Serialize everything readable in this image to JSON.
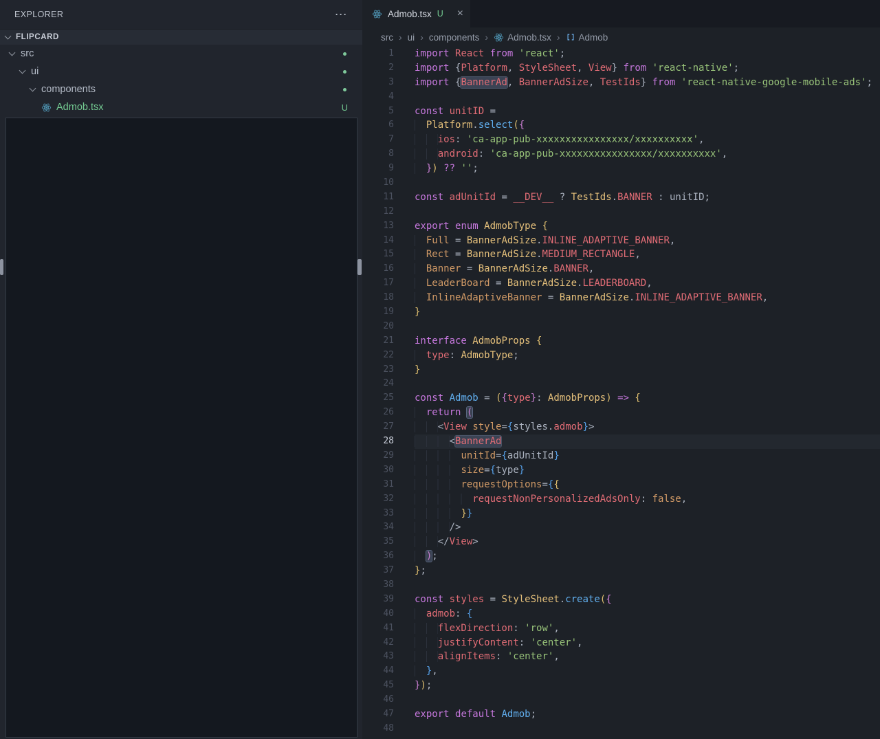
{
  "colors": {
    "react_icon": "#519aba",
    "git_untracked": "#73c991",
    "accent_keyword": "#c678dd"
  },
  "explorer": {
    "header": "EXPLORER",
    "more_icon": "⋯",
    "section": "FLIPCARD",
    "tree": [
      {
        "label": "src",
        "kind": "folder",
        "depth": 0,
        "badge": "dot"
      },
      {
        "label": "ui",
        "kind": "folder",
        "depth": 1,
        "badge": "dot"
      },
      {
        "label": "components",
        "kind": "folder",
        "depth": 2,
        "badge": "dot"
      },
      {
        "label": "Admob.tsx",
        "kind": "react-file",
        "depth": 3,
        "badge": "U"
      }
    ]
  },
  "tab": {
    "icon": "react-icon",
    "title": "Admob.tsx",
    "git_status": "U",
    "close_icon": "×"
  },
  "breadcrumb_separator": "›",
  "breadcrumbs": [
    {
      "label": "src"
    },
    {
      "label": "ui"
    },
    {
      "label": "components"
    },
    {
      "label": "Admob.tsx",
      "icon": "react-icon"
    },
    {
      "label": "Admob",
      "icon": "symbol-icon"
    }
  ],
  "editor": {
    "active_line": 28,
    "lines": [
      {
        "n": 1,
        "t": [
          [
            "kw",
            "import"
          ],
          [
            "def",
            " "
          ],
          [
            "var",
            "React"
          ],
          [
            "def",
            " "
          ],
          [
            "kw",
            "from"
          ],
          [
            "def",
            " "
          ],
          [
            "str",
            "'react'"
          ],
          [
            "def",
            ";"
          ]
        ]
      },
      {
        "n": 2,
        "t": [
          [
            "kw",
            "import"
          ],
          [
            "def",
            " {"
          ],
          [
            "var",
            "Platform"
          ],
          [
            "def",
            ", "
          ],
          [
            "var",
            "StyleSheet"
          ],
          [
            "def",
            ", "
          ],
          [
            "var",
            "View"
          ],
          [
            "def",
            "} "
          ],
          [
            "kw",
            "from"
          ],
          [
            "def",
            " "
          ],
          [
            "str",
            "'react-native'"
          ],
          [
            "def",
            ";"
          ]
        ]
      },
      {
        "n": 3,
        "t": [
          [
            "kw",
            "import"
          ],
          [
            "def",
            " {"
          ],
          [
            "var",
            "BannerAd",
            "hl"
          ],
          [
            "def",
            ", "
          ],
          [
            "var",
            "BannerAdSize"
          ],
          [
            "def",
            ", "
          ],
          [
            "var",
            "TestIds"
          ],
          [
            "def",
            "} "
          ],
          [
            "kw",
            "from"
          ],
          [
            "def",
            " "
          ],
          [
            "str",
            "'react-native-google-mobile-ads'"
          ],
          [
            "def",
            ";"
          ]
        ]
      },
      {
        "n": 4,
        "t": []
      },
      {
        "n": 5,
        "t": [
          [
            "kw",
            "const"
          ],
          [
            "def",
            " "
          ],
          [
            "var",
            "unitID"
          ],
          [
            "def",
            " ="
          ]
        ]
      },
      {
        "n": 6,
        "t": [
          [
            "ind",
            "  "
          ],
          [
            "typ",
            "Platform"
          ],
          [
            "def",
            "."
          ],
          [
            "fn",
            "select"
          ],
          [
            "b1",
            "("
          ],
          [
            "b2",
            "{"
          ]
        ]
      },
      {
        "n": 7,
        "t": [
          [
            "ind",
            "    "
          ],
          [
            "var",
            "ios"
          ],
          [
            "def",
            ": "
          ],
          [
            "str",
            "'ca-app-pub-xxxxxxxxxxxxxxxx/xxxxxxxxxx'"
          ],
          [
            "def",
            ","
          ]
        ]
      },
      {
        "n": 8,
        "t": [
          [
            "ind",
            "    "
          ],
          [
            "var",
            "android"
          ],
          [
            "def",
            ": "
          ],
          [
            "str",
            "'ca-app-pub-xxxxxxxxxxxxxxxx/xxxxxxxxxx'"
          ],
          [
            "def",
            ","
          ]
        ]
      },
      {
        "n": 9,
        "t": [
          [
            "ind",
            "  "
          ],
          [
            "b2",
            "}"
          ],
          [
            "b1",
            ")"
          ],
          [
            "def",
            " "
          ],
          [
            "kw",
            "??"
          ],
          [
            "def",
            " "
          ],
          [
            "str",
            "''"
          ],
          [
            "def",
            ";"
          ]
        ]
      },
      {
        "n": 10,
        "t": []
      },
      {
        "n": 11,
        "t": [
          [
            "kw",
            "const"
          ],
          [
            "def",
            " "
          ],
          [
            "var",
            "adUnitId"
          ],
          [
            "def",
            " = "
          ],
          [
            "var",
            "__DEV__"
          ],
          [
            "def",
            " ? "
          ],
          [
            "typ",
            "TestIds"
          ],
          [
            "def",
            "."
          ],
          [
            "var",
            "BANNER"
          ],
          [
            "def",
            " : "
          ],
          [
            "def",
            "unitID"
          ],
          [
            "def",
            ";"
          ]
        ]
      },
      {
        "n": 12,
        "t": []
      },
      {
        "n": 13,
        "t": [
          [
            "kw",
            "export"
          ],
          [
            "def",
            " "
          ],
          [
            "kw",
            "enum"
          ],
          [
            "def",
            " "
          ],
          [
            "typ",
            "AdmobType"
          ],
          [
            "def",
            " "
          ],
          [
            "b1",
            "{"
          ]
        ]
      },
      {
        "n": 14,
        "t": [
          [
            "ind",
            "  "
          ],
          [
            "orn",
            "Full"
          ],
          [
            "def",
            " = "
          ],
          [
            "typ",
            "BannerAdSize"
          ],
          [
            "def",
            "."
          ],
          [
            "var",
            "INLINE_ADAPTIVE_BANNER"
          ],
          [
            "def",
            ","
          ]
        ]
      },
      {
        "n": 15,
        "t": [
          [
            "ind",
            "  "
          ],
          [
            "orn",
            "Rect"
          ],
          [
            "def",
            " = "
          ],
          [
            "typ",
            "BannerAdSize"
          ],
          [
            "def",
            "."
          ],
          [
            "var",
            "MEDIUM_RECTANGLE"
          ],
          [
            "def",
            ","
          ]
        ]
      },
      {
        "n": 16,
        "t": [
          [
            "ind",
            "  "
          ],
          [
            "orn",
            "Banner"
          ],
          [
            "def",
            " = "
          ],
          [
            "typ",
            "BannerAdSize"
          ],
          [
            "def",
            "."
          ],
          [
            "var",
            "BANNER"
          ],
          [
            "def",
            ","
          ]
        ]
      },
      {
        "n": 17,
        "t": [
          [
            "ind",
            "  "
          ],
          [
            "orn",
            "LeaderBoard"
          ],
          [
            "def",
            " = "
          ],
          [
            "typ",
            "BannerAdSize"
          ],
          [
            "def",
            "."
          ],
          [
            "var",
            "LEADERBOARD"
          ],
          [
            "def",
            ","
          ]
        ]
      },
      {
        "n": 18,
        "t": [
          [
            "ind",
            "  "
          ],
          [
            "orn",
            "InlineAdaptiveBanner"
          ],
          [
            "def",
            " = "
          ],
          [
            "typ",
            "BannerAdSize"
          ],
          [
            "def",
            "."
          ],
          [
            "var",
            "INLINE_ADAPTIVE_BANNER"
          ],
          [
            "def",
            ","
          ]
        ]
      },
      {
        "n": 19,
        "t": [
          [
            "b1",
            "}"
          ]
        ]
      },
      {
        "n": 20,
        "t": []
      },
      {
        "n": 21,
        "t": [
          [
            "kw",
            "interface"
          ],
          [
            "def",
            " "
          ],
          [
            "typ",
            "AdmobProps"
          ],
          [
            "def",
            " "
          ],
          [
            "b1",
            "{"
          ]
        ]
      },
      {
        "n": 22,
        "t": [
          [
            "ind",
            "  "
          ],
          [
            "var",
            "type"
          ],
          [
            "def",
            ": "
          ],
          [
            "typ",
            "AdmobType"
          ],
          [
            "def",
            ";"
          ]
        ]
      },
      {
        "n": 23,
        "t": [
          [
            "b1",
            "}"
          ]
        ]
      },
      {
        "n": 24,
        "t": []
      },
      {
        "n": 25,
        "t": [
          [
            "kw",
            "const"
          ],
          [
            "def",
            " "
          ],
          [
            "fn",
            "Admob"
          ],
          [
            "def",
            " = "
          ],
          [
            "b1",
            "("
          ],
          [
            "b2",
            "{"
          ],
          [
            "var",
            "type"
          ],
          [
            "b2",
            "}"
          ],
          [
            "def",
            ": "
          ],
          [
            "typ",
            "AdmobProps"
          ],
          [
            "b1",
            ")"
          ],
          [
            "def",
            " "
          ],
          [
            "kw",
            "=>"
          ],
          [
            "def",
            " "
          ],
          [
            "b1",
            "{"
          ]
        ]
      },
      {
        "n": 26,
        "t": [
          [
            "ind",
            "  "
          ],
          [
            "kw",
            "return"
          ],
          [
            "def",
            " "
          ],
          [
            "b2",
            "(",
            "bm"
          ]
        ]
      },
      {
        "n": 27,
        "t": [
          [
            "ind",
            "    "
          ],
          [
            "def",
            "<"
          ],
          [
            "var",
            "View"
          ],
          [
            "def",
            " "
          ],
          [
            "orn",
            "style"
          ],
          [
            "def",
            "="
          ],
          [
            "b3",
            "{"
          ],
          [
            "def",
            "styles"
          ],
          [
            "def",
            "."
          ],
          [
            "var",
            "admob"
          ],
          [
            "b3",
            "}"
          ],
          [
            "def",
            ">"
          ]
        ]
      },
      {
        "n": 28,
        "t": [
          [
            "ind",
            "      "
          ],
          [
            "def",
            "<"
          ],
          [
            "var",
            "BannerAd",
            "hl"
          ]
        ]
      },
      {
        "n": 29,
        "t": [
          [
            "ind",
            "        "
          ],
          [
            "orn",
            "unitId"
          ],
          [
            "def",
            "="
          ],
          [
            "b3",
            "{"
          ],
          [
            "def",
            "adUnitId"
          ],
          [
            "b3",
            "}"
          ]
        ]
      },
      {
        "n": 30,
        "t": [
          [
            "ind",
            "        "
          ],
          [
            "orn",
            "size"
          ],
          [
            "def",
            "="
          ],
          [
            "b3",
            "{"
          ],
          [
            "def",
            "type"
          ],
          [
            "b3",
            "}"
          ]
        ]
      },
      {
        "n": 31,
        "t": [
          [
            "ind",
            "        "
          ],
          [
            "orn",
            "requestOptions"
          ],
          [
            "def",
            "="
          ],
          [
            "b3",
            "{"
          ],
          [
            "b1",
            "{"
          ]
        ]
      },
      {
        "n": 32,
        "t": [
          [
            "ind",
            "          "
          ],
          [
            "var",
            "requestNonPersonalizedAdsOnly"
          ],
          [
            "def",
            ": "
          ],
          [
            "orn",
            "false"
          ],
          [
            "def",
            ","
          ]
        ]
      },
      {
        "n": 33,
        "t": [
          [
            "ind",
            "        "
          ],
          [
            "b1",
            "}"
          ],
          [
            "b3",
            "}"
          ]
        ]
      },
      {
        "n": 34,
        "t": [
          [
            "ind",
            "      "
          ],
          [
            "def",
            "/>"
          ]
        ]
      },
      {
        "n": 35,
        "t": [
          [
            "ind",
            "    "
          ],
          [
            "def",
            "</"
          ],
          [
            "var",
            "View"
          ],
          [
            "def",
            ">"
          ]
        ]
      },
      {
        "n": 36,
        "t": [
          [
            "ind",
            "  "
          ],
          [
            "b2",
            ")",
            "bm"
          ],
          [
            "def",
            ";"
          ]
        ]
      },
      {
        "n": 37,
        "t": [
          [
            "b1",
            "}"
          ],
          [
            "def",
            ";"
          ]
        ]
      },
      {
        "n": 38,
        "t": []
      },
      {
        "n": 39,
        "t": [
          [
            "kw",
            "const"
          ],
          [
            "def",
            " "
          ],
          [
            "var",
            "styles"
          ],
          [
            "def",
            " = "
          ],
          [
            "typ",
            "StyleSheet"
          ],
          [
            "def",
            "."
          ],
          [
            "fn",
            "create"
          ],
          [
            "b1",
            "("
          ],
          [
            "b2",
            "{"
          ]
        ]
      },
      {
        "n": 40,
        "t": [
          [
            "ind",
            "  "
          ],
          [
            "var",
            "admob"
          ],
          [
            "def",
            ": "
          ],
          [
            "b3",
            "{"
          ]
        ]
      },
      {
        "n": 41,
        "t": [
          [
            "ind",
            "    "
          ],
          [
            "var",
            "flexDirection"
          ],
          [
            "def",
            ": "
          ],
          [
            "str",
            "'row'"
          ],
          [
            "def",
            ","
          ]
        ]
      },
      {
        "n": 42,
        "t": [
          [
            "ind",
            "    "
          ],
          [
            "var",
            "justifyContent"
          ],
          [
            "def",
            ": "
          ],
          [
            "str",
            "'center'"
          ],
          [
            "def",
            ","
          ]
        ]
      },
      {
        "n": 43,
        "t": [
          [
            "ind",
            "    "
          ],
          [
            "var",
            "alignItems"
          ],
          [
            "def",
            ": "
          ],
          [
            "str",
            "'center'"
          ],
          [
            "def",
            ","
          ]
        ]
      },
      {
        "n": 44,
        "t": [
          [
            "ind",
            "  "
          ],
          [
            "b3",
            "}"
          ],
          [
            "def",
            ","
          ]
        ]
      },
      {
        "n": 45,
        "t": [
          [
            "b2",
            "}"
          ],
          [
            "b1",
            ")"
          ],
          [
            "def",
            ";"
          ]
        ]
      },
      {
        "n": 46,
        "t": []
      },
      {
        "n": 47,
        "t": [
          [
            "kw",
            "export"
          ],
          [
            "def",
            " "
          ],
          [
            "kw",
            "default"
          ],
          [
            "def",
            " "
          ],
          [
            "fn",
            "Admob"
          ],
          [
            "def",
            ";"
          ]
        ]
      },
      {
        "n": 48,
        "t": []
      }
    ]
  }
}
